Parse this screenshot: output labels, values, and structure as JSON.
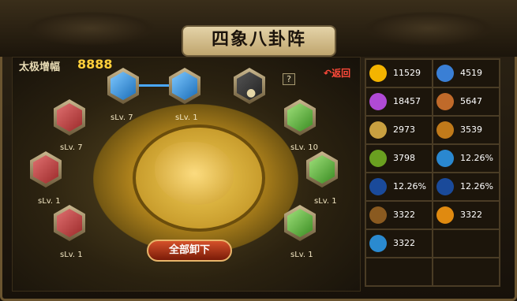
{
  "title": "四象八卦阵",
  "power": {
    "label": "太极增幅",
    "value": "8888"
  },
  "help_label": "?",
  "return_label": "返回",
  "unload_all_label": "全部卸下",
  "slots": [
    {
      "label": "sLv. 7",
      "color": "blue"
    },
    {
      "label": "sLv. 1",
      "color": "blue"
    },
    {
      "label": "",
      "color": "locked"
    },
    {
      "label": "sLv. 7",
      "color": "red"
    },
    {
      "label": "sLv. 10",
      "color": "green"
    },
    {
      "label": "sLv. 1",
      "color": "red"
    },
    {
      "label": "sLv. 1",
      "color": "green"
    },
    {
      "label": "sLv. 1",
      "color": "red"
    },
    {
      "label": "sLv. 1",
      "color": "green"
    }
  ],
  "stats": [
    {
      "value": "11529",
      "icon": "orb-icon",
      "color": "#f4b400"
    },
    {
      "value": "4519",
      "icon": "shield-icon",
      "color": "#3a7fd5"
    },
    {
      "value": "18457",
      "icon": "orb-icon",
      "color": "#b04ad5"
    },
    {
      "value": "5647",
      "icon": "warrior-icon",
      "color": "#c06a2a"
    },
    {
      "value": "2973",
      "icon": "hammer-icon",
      "color": "#c9a040"
    },
    {
      "value": "3539",
      "icon": "beast-icon",
      "color": "#c07a1a"
    },
    {
      "value": "3798",
      "icon": "sword-icon",
      "color": "#6aa020"
    },
    {
      "value": "12.26%",
      "icon": "spark-icon",
      "color": "#2a88d0"
    },
    {
      "value": "12.26%",
      "icon": "dagger-icon",
      "color": "#1a4a9a"
    },
    {
      "value": "12.26%",
      "icon": "arrow-icon",
      "color": "#1a4a9a"
    },
    {
      "value": "3322",
      "icon": "beast-icon",
      "color": "#8a5a20"
    },
    {
      "value": "3322",
      "icon": "explosion-icon",
      "color": "#e08a10"
    },
    {
      "value": "3322",
      "icon": "wave-icon",
      "color": "#2a8ad0"
    },
    {
      "value": "",
      "icon": "",
      "color": ""
    },
    {
      "value": "",
      "icon": "",
      "color": ""
    },
    {
      "value": "",
      "icon": "",
      "color": ""
    }
  ]
}
